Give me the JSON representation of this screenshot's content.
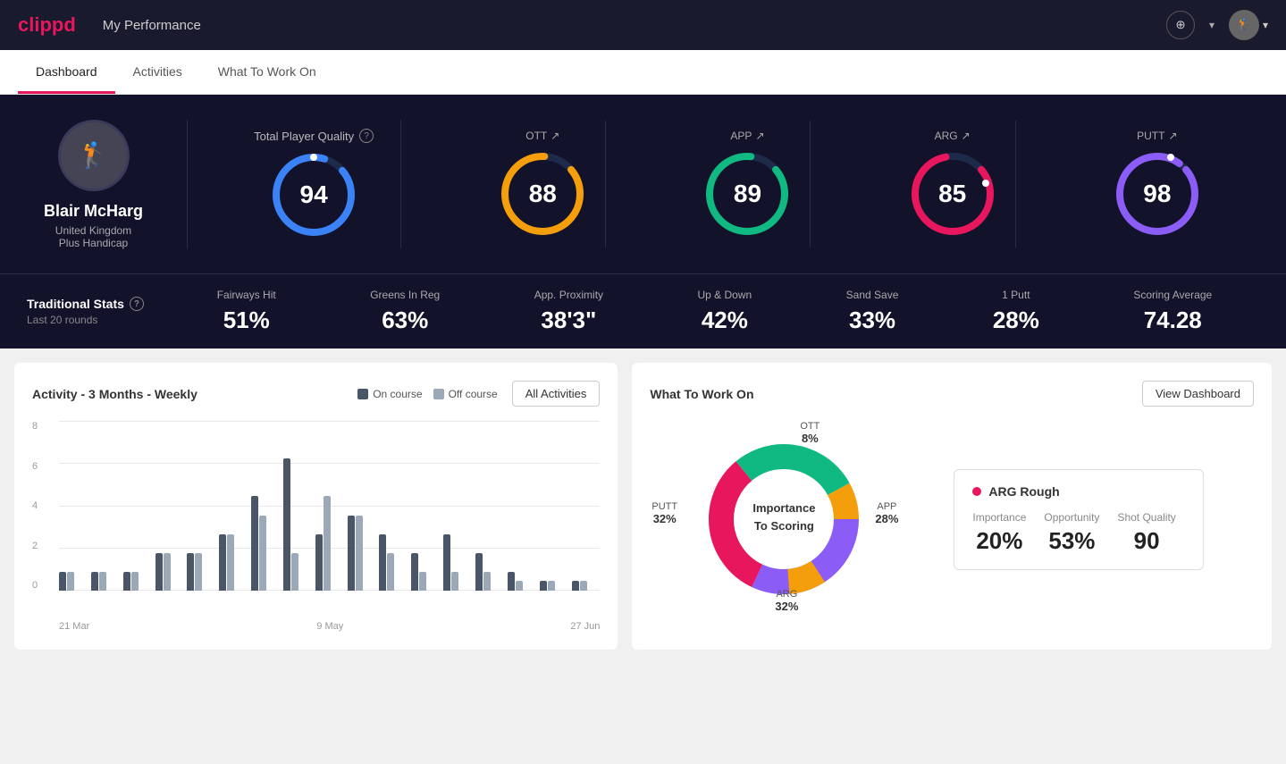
{
  "app": {
    "logo": "clippd",
    "nav_title": "My Performance",
    "add_icon": "⊕",
    "chevron": "▾"
  },
  "tabs": [
    {
      "label": "Dashboard",
      "active": true
    },
    {
      "label": "Activities",
      "active": false
    },
    {
      "label": "What To Work On",
      "active": false
    }
  ],
  "player": {
    "name": "Blair McHarg",
    "country": "United Kingdom",
    "handicap": "Plus Handicap",
    "avatar_initial": "🏌"
  },
  "tpq": {
    "label": "Total Player Quality",
    "help": "?",
    "value": 94,
    "color": "#3b82f6"
  },
  "scores": [
    {
      "label": "OTT",
      "value": 88,
      "color": "#f59e0b",
      "arrow": "↗"
    },
    {
      "label": "APP",
      "value": 89,
      "color": "#10b981",
      "arrow": "↗"
    },
    {
      "label": "ARG",
      "value": 85,
      "color": "#e8175d",
      "arrow": "↗"
    },
    {
      "label": "PUTT",
      "value": 98,
      "color": "#8b5cf6",
      "arrow": "↗"
    }
  ],
  "stats": {
    "title": "Traditional Stats",
    "help": "?",
    "subtitle": "Last 20 rounds",
    "items": [
      {
        "name": "Fairways Hit",
        "value": "51%"
      },
      {
        "name": "Greens In Reg",
        "value": "63%"
      },
      {
        "name": "App. Proximity",
        "value": "38'3\""
      },
      {
        "name": "Up & Down",
        "value": "42%"
      },
      {
        "name": "Sand Save",
        "value": "33%"
      },
      {
        "name": "1 Putt",
        "value": "28%"
      },
      {
        "name": "Scoring Average",
        "value": "74.28"
      }
    ]
  },
  "chart": {
    "title": "Activity - 3 Months - Weekly",
    "legend": {
      "on_course": "On course",
      "off_course": "Off course"
    },
    "all_activities_btn": "All Activities",
    "y_labels": [
      "0",
      "2",
      "4",
      "6",
      "8"
    ],
    "x_labels": [
      "21 Mar",
      "9 May",
      "27 Jun"
    ],
    "bars": [
      {
        "on": 1,
        "off": 1
      },
      {
        "on": 1,
        "off": 1
      },
      {
        "on": 1,
        "off": 1
      },
      {
        "on": 2,
        "off": 2
      },
      {
        "on": 2,
        "off": 2
      },
      {
        "on": 3,
        "off": 3
      },
      {
        "on": 5,
        "off": 4
      },
      {
        "on": 7,
        "off": 2
      },
      {
        "on": 3,
        "off": 5
      },
      {
        "on": 4,
        "off": 4
      },
      {
        "on": 3,
        "off": 2
      },
      {
        "on": 2,
        "off": 1
      },
      {
        "on": 3,
        "off": 1
      },
      {
        "on": 2,
        "off": 1
      },
      {
        "on": 1,
        "off": 0.5
      },
      {
        "on": 0.5,
        "off": 0.5
      },
      {
        "on": 0.5,
        "off": 0.5
      }
    ],
    "max_value": 9
  },
  "work_on": {
    "title": "What To Work On",
    "view_dashboard_btn": "View Dashboard",
    "donut_center_line1": "Importance",
    "donut_center_line2": "To Scoring",
    "segments": [
      {
        "label": "OTT",
        "pct": "8%",
        "color": "#f59e0b"
      },
      {
        "label": "APP",
        "pct": "28%",
        "color": "#10b981"
      },
      {
        "label": "ARG",
        "pct": "32%",
        "color": "#e8175d"
      },
      {
        "label": "PUTT",
        "pct": "32%",
        "color": "#8b5cf6"
      }
    ],
    "arg_card": {
      "title": "ARG Rough",
      "metrics": [
        {
          "name": "Importance",
          "value": "20%"
        },
        {
          "name": "Opportunity",
          "value": "53%"
        },
        {
          "name": "Shot Quality",
          "value": "90"
        }
      ]
    }
  }
}
